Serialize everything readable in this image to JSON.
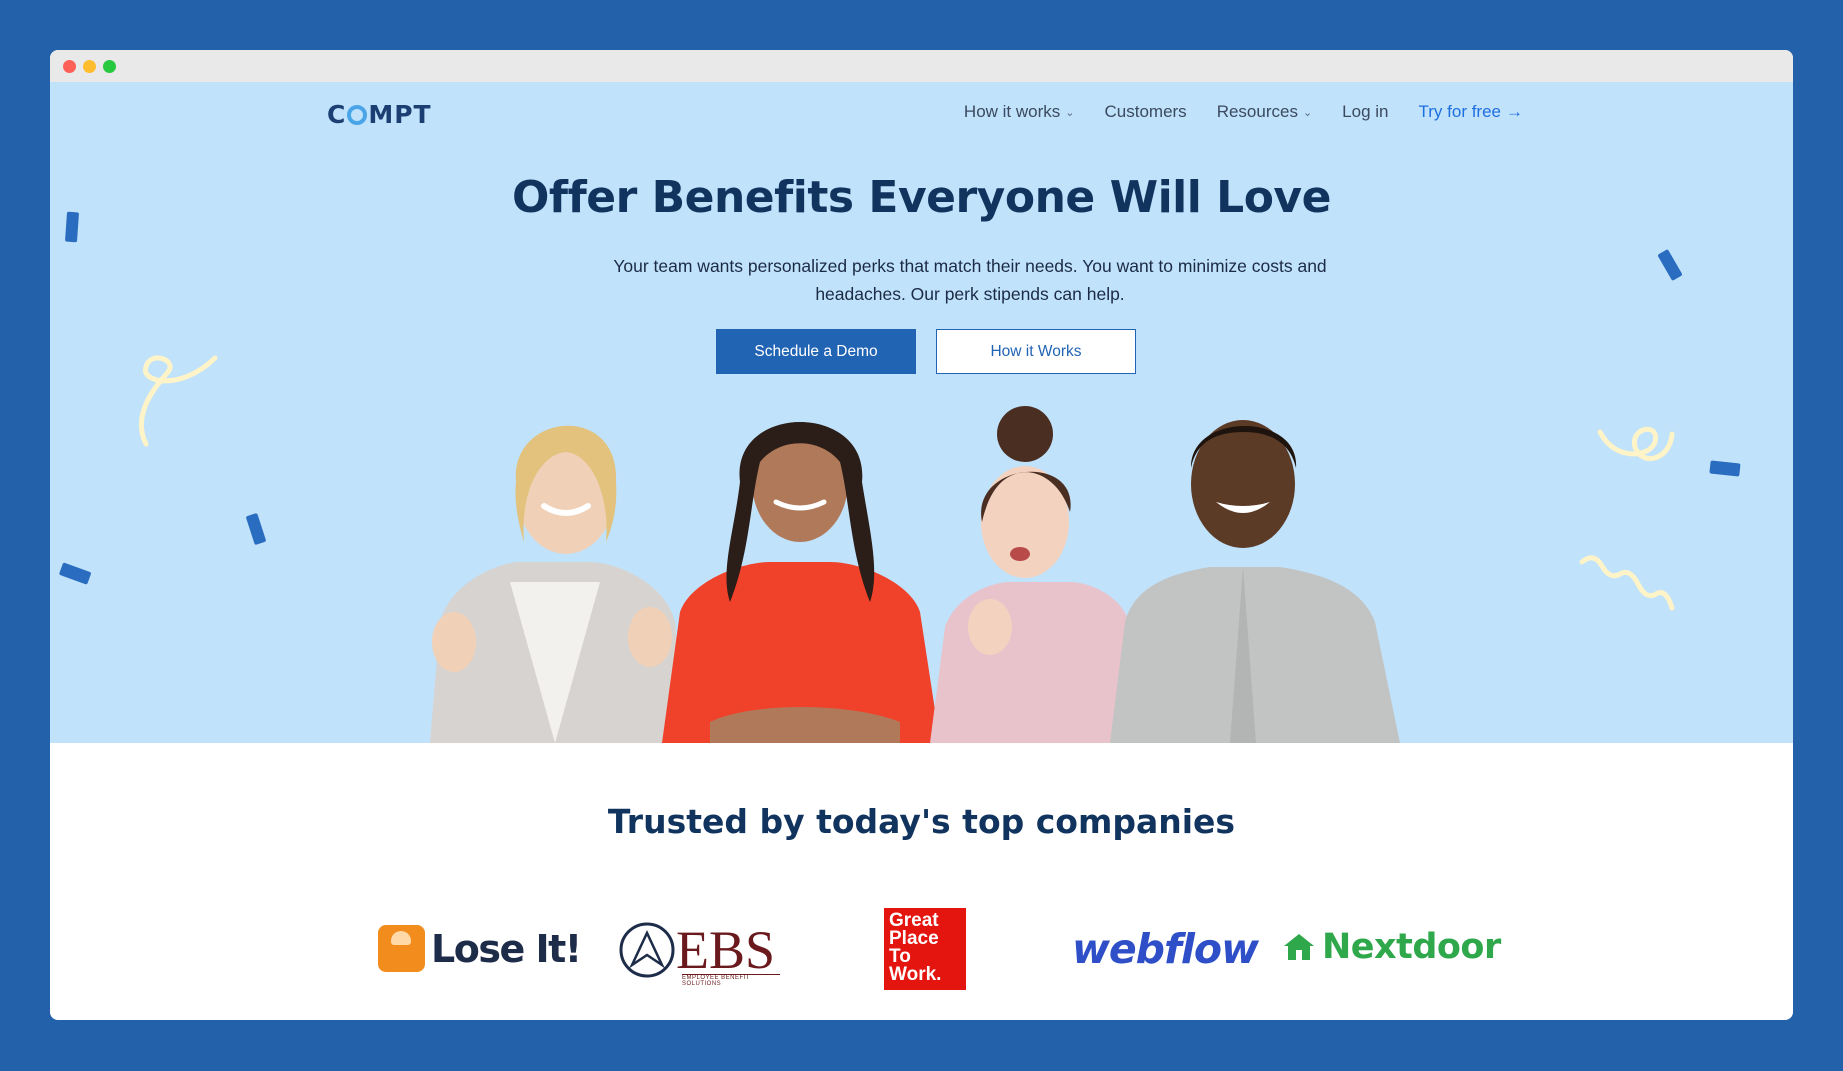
{
  "window": {
    "controls": [
      "close",
      "minimize",
      "zoom"
    ]
  },
  "brand": {
    "logo_left": "C",
    "logo_right": "MPT",
    "logo_full": "COMPT"
  },
  "nav": {
    "items": [
      {
        "label": "How it works",
        "has_dropdown": true
      },
      {
        "label": "Customers",
        "has_dropdown": false
      },
      {
        "label": "Resources",
        "has_dropdown": true
      },
      {
        "label": "Log in",
        "has_dropdown": false
      }
    ],
    "cta": {
      "label": "Try for free",
      "arrow": "→"
    }
  },
  "hero": {
    "headline_pre": "Offer Benefits ",
    "headline_highlight": "Everyone",
    "headline_post": " Will Love",
    "subtext": "Your team wants personalized perks that match their needs. You want to minimize costs and headaches. Our perk stipends can help.",
    "primary_button": "Schedule a Demo",
    "secondary_button": "How it Works"
  },
  "trusted": {
    "heading": "Trusted by today's top companies",
    "logos": {
      "loseit": "Lose It!",
      "ebs": "EBS",
      "ebs_sub": "EMPLOYEE BENEFIT SOLUTIONS",
      "gptw": [
        "Great",
        "Place",
        "To",
        "Work."
      ],
      "webflow": "webflow",
      "nextdoor": "Nextdoor"
    }
  },
  "colors": {
    "page_bg": "#2361ab",
    "hero_bg": "#c0e2fb",
    "navy": "#11345f",
    "primary": "#2264b4",
    "highlight": "#f2a93b",
    "link": "#1f6fe0"
  }
}
